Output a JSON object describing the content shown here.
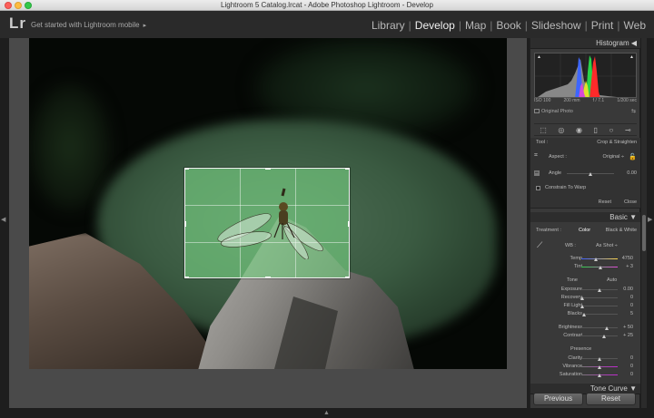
{
  "window": {
    "title": "Lightroom 5 Catalog.lrcat - Adobe Photoshop Lightroom - Develop"
  },
  "topbar": {
    "logo": "Lr",
    "get_started": "Get started with Lightroom mobile",
    "get_started_arrow": "▸",
    "modules": [
      "Library",
      "Develop",
      "Map",
      "Book",
      "Slideshow",
      "Print",
      "Web"
    ],
    "active_module": "Develop",
    "separator": "|"
  },
  "histogram": {
    "header": "Histogram",
    "header_arrow": "◀",
    "iso": "ISO 100",
    "focal": "200 mm",
    "aperture": "f / 7.1",
    "shutter": "1/200 sec",
    "original_label": "Original Photo"
  },
  "crop": {
    "tool_label": "Tool :",
    "tool_value": "Crop & Straighten",
    "aspect_label": "Aspect :",
    "aspect_value": "Original",
    "aspect_arrow": "÷",
    "angle_label": "Angle",
    "angle_value": "0.00",
    "constrain_label": "Constrain To Warp",
    "reset_label": "Reset",
    "close_label": "Close"
  },
  "basic": {
    "header": "Basic",
    "header_arrow": "▼",
    "treatment_label": "Treatment :",
    "color_label": "Color",
    "bw_label": "Black & White",
    "wb_label": "WB :",
    "wb_value": "As Shot",
    "wb_arrow": "÷",
    "temp_label": "Temp",
    "temp_value": "4750",
    "tint_label": "Tint",
    "tint_value": "+ 3",
    "tone_label": "Tone",
    "auto_label": "Auto",
    "exposure_label": "Exposure",
    "exposure_value": "0.00",
    "recovery_label": "Recovery",
    "recovery_value": "0",
    "filllight_label": "Fill Light",
    "filllight_value": "0",
    "blacks_label": "Blacks",
    "blacks_value": "5",
    "brightness_label": "Brightness",
    "brightness_value": "+ 50",
    "contrast_label": "Contrast",
    "contrast_value": "+ 25",
    "presence_label": "Presence",
    "clarity_label": "Clarity",
    "clarity_value": "0",
    "vibrance_label": "Vibrance",
    "vibrance_value": "0",
    "saturation_label": "Saturation",
    "saturation_value": "0"
  },
  "tone_curve": {
    "header": "Tone Curve",
    "header_arrow": "▼"
  },
  "buttons": {
    "previous": "Previous",
    "reset": "Reset"
  },
  "panel_arrows": {
    "left": "◀",
    "right": "▶",
    "bottom": "▲"
  },
  "colors": {
    "accent": "#2a2a2a",
    "crop_overlay": "#78d282"
  }
}
